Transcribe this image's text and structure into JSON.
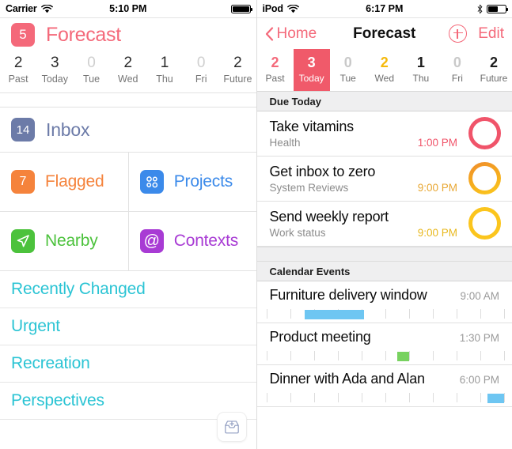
{
  "colors": {
    "pink": "#f4697a",
    "pink_strong": "#f05a6a",
    "inbox_blue": "#6c7ba8",
    "flag_orange": "#f5833c",
    "project_blue": "#3b8aea",
    "nearby_green": "#4cc game",
    "green": "#4cc23c",
    "purple": "#a83bd4",
    "teal": "#2bc4d4",
    "amber": "#f5b90a",
    "orange_ring": "#f2a23a",
    "yellow_ring": "#fbc51d",
    "red_ring": "#f0546a",
    "sky": "#6ec6f2",
    "event_green": "#78d260"
  },
  "left": {
    "statusbar": {
      "carrier": "Carrier",
      "time": "5:10 PM",
      "wifi_icon": "wifi-icon",
      "battery_icon": "battery-icon",
      "battery_level": 100
    },
    "header": {
      "badge_count": "5",
      "title": "Forecast",
      "badge_color": "#f4697a"
    },
    "days": [
      {
        "count": "2",
        "label": "Past",
        "muted": false,
        "selected": false,
        "color": "#2b2b2b"
      },
      {
        "count": "3",
        "label": "Today",
        "muted": false,
        "selected": false,
        "color": "#2b2b2b"
      },
      {
        "count": "0",
        "label": "Tue",
        "muted": true,
        "selected": false,
        "color": "#c9c9c9"
      },
      {
        "count": "2",
        "label": "Wed",
        "muted": false,
        "selected": false,
        "color": "#2b2b2b"
      },
      {
        "count": "1",
        "label": "Thu",
        "muted": false,
        "selected": false,
        "color": "#2b2b2b"
      },
      {
        "count": "0",
        "label": "Fri",
        "muted": true,
        "selected": false,
        "color": "#c9c9c9"
      },
      {
        "count": "2",
        "label": "Future",
        "muted": false,
        "selected": false,
        "color": "#2b2b2b"
      }
    ],
    "inbox": {
      "count": "14",
      "label": "Inbox",
      "color": "#6c7ba8",
      "icon": "inbox-badge-icon"
    },
    "tiles": [
      {
        "label": "Flagged",
        "badge": "7",
        "color": "#f5833c",
        "icon": "flag-badge-icon",
        "name": "flagged"
      },
      {
        "label": "Projects",
        "badge": "",
        "color": "#3b8aea",
        "icon": "projects-icon",
        "name": "projects"
      },
      {
        "label": "Nearby",
        "badge": "",
        "color": "#4cc23c",
        "icon": "location-arrow-icon",
        "name": "nearby"
      },
      {
        "label": "Contexts",
        "badge": "@",
        "color": "#a83bd4",
        "icon": "at-sign-icon",
        "name": "contexts"
      }
    ],
    "perspectives": [
      {
        "label": "Recently Changed"
      },
      {
        "label": "Urgent"
      },
      {
        "label": "Recreation"
      },
      {
        "label": "Perspectives"
      }
    ],
    "fab": {
      "icon": "inbox-tray-add-icon",
      "color": "#8f9cc0"
    }
  },
  "right": {
    "statusbar": {
      "carrier": "iPod",
      "time": "6:17 PM",
      "wifi_icon": "wifi-icon",
      "bluetooth_icon": "bluetooth-icon",
      "battery_icon": "battery-icon",
      "battery_level": 55
    },
    "nav": {
      "back_label": "Home",
      "back_icon": "chevron-left-icon",
      "title": "Forecast",
      "add_icon": "plus-circle-icon",
      "edit_label": "Edit"
    },
    "days": [
      {
        "count": "2",
        "label": "Past",
        "color": "#f4697a",
        "selected": false
      },
      {
        "count": "3",
        "label": "Today",
        "color": "#ffffff",
        "selected": true
      },
      {
        "count": "0",
        "label": "Tue",
        "color": "#c9c9c9",
        "selected": false
      },
      {
        "count": "2",
        "label": "Wed",
        "color": "#f5b90a",
        "selected": false
      },
      {
        "count": "1",
        "label": "Thu",
        "color": "#1c1c1c",
        "selected": false
      },
      {
        "count": "0",
        "label": "Fri",
        "color": "#c9c9c9",
        "selected": false
      },
      {
        "count": "2",
        "label": "Future",
        "color": "#1c1c1c",
        "selected": false
      }
    ],
    "due_today": {
      "header": "Due Today",
      "tasks": [
        {
          "title": "Take vitamins",
          "project": "Health",
          "time": "1:00 PM",
          "time_color": "#f0546a",
          "ring_color": "#f0546a",
          "ring_gradient": false
        },
        {
          "title": "Get inbox to zero",
          "project": "System Reviews",
          "time": "9:00 PM",
          "time_color": "#e8a733",
          "ring_color": "#f2a23a",
          "ring_gradient": true
        },
        {
          "title": "Send weekly report",
          "project": "Work status",
          "time": "9:00 PM",
          "time_color": "#e8b81d",
          "ring_color": "#fbc51d",
          "ring_gradient": false
        }
      ]
    },
    "calendar": {
      "header": "Calendar Events",
      "events": [
        {
          "title": "Furniture delivery window",
          "time": "9:00 AM",
          "block_start_pct": 16,
          "block_width_pct": 25,
          "block_color": "#6ec6f2",
          "ticks": 11
        },
        {
          "title": "Product meeting",
          "time": "1:30 PM",
          "block_start_pct": 55,
          "block_width_pct": 5,
          "block_color": "#78d260",
          "ticks": 11
        },
        {
          "title": "Dinner with Ada and Alan",
          "time": "6:00 PM",
          "block_start_pct": 93,
          "block_width_pct": 7,
          "block_color": "#6ec6f2",
          "ticks": 11
        }
      ]
    },
    "fab": {
      "icon": "inbox-tray-add-icon",
      "color": "#f2a0ab"
    }
  }
}
